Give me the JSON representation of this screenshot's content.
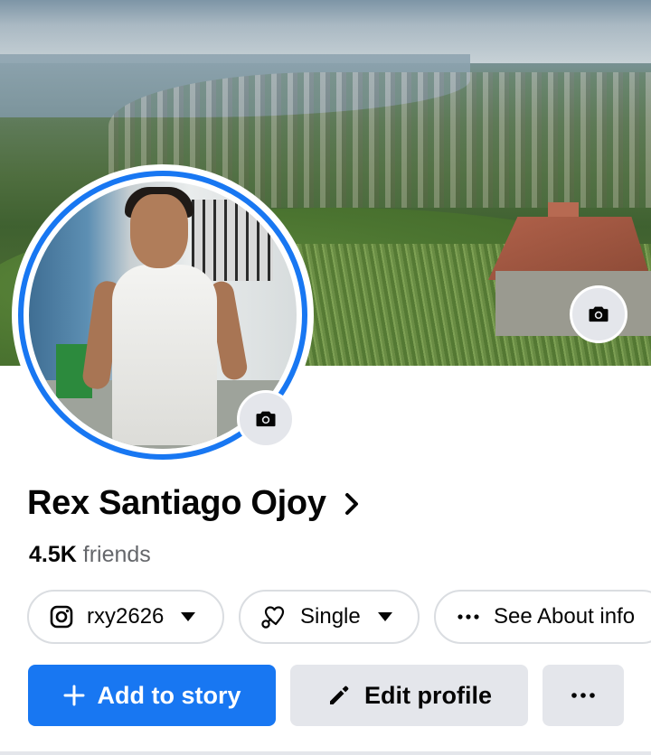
{
  "profile": {
    "name": "Rex Santiago Ojoy",
    "friends_count": "4.5K",
    "friends_label": "friends"
  },
  "chips": {
    "instagram": {
      "label": "rxy2626",
      "icon": "instagram-icon"
    },
    "relationship": {
      "label": "Single",
      "icon": "heart-link-icon"
    },
    "about": {
      "label": "See About info",
      "icon": "more-dots-icon"
    }
  },
  "actions": {
    "add_story_label": "Add to story",
    "edit_profile_label": "Edit profile",
    "more_icon": "more-dots-icon"
  },
  "icons": {
    "cover_camera": "camera-icon",
    "avatar_camera": "camera-icon",
    "name_chevron": "chevron-right-icon"
  },
  "colors": {
    "accent": "#1877f2",
    "secondary_button": "#e4e6eb",
    "muted_text": "#65676b",
    "chip_border": "#dadde1"
  }
}
